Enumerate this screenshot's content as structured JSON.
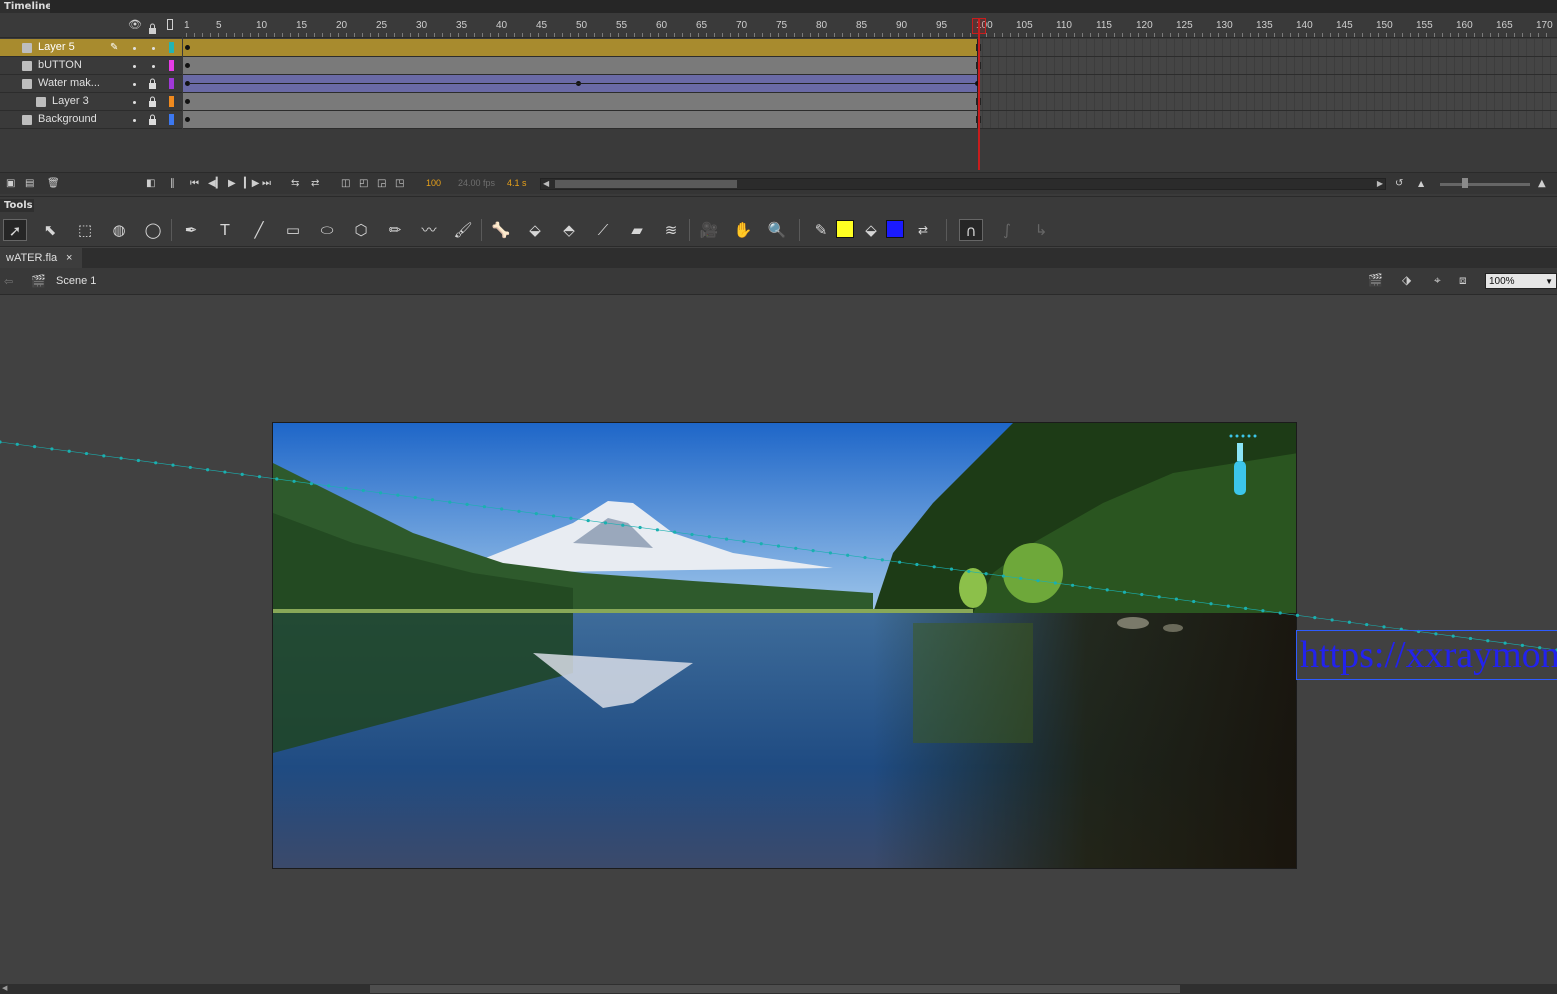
{
  "timeline": {
    "tab_label": "Timeline",
    "ruler_ticks": [
      "1",
      "5",
      "10",
      "15",
      "20",
      "25",
      "30",
      "35",
      "40",
      "45",
      "50",
      "55",
      "60",
      "65",
      "70",
      "75",
      "80",
      "85",
      "90",
      "95",
      "100",
      "105",
      "110",
      "115",
      "120",
      "125",
      "130",
      "135",
      "140",
      "145",
      "150",
      "155",
      "160",
      "165",
      "170"
    ],
    "layers": [
      {
        "name": "Layer 5",
        "color": "#23b4b4",
        "selected": true
      },
      {
        "name": "bUTTON",
        "color": "#e63ce6",
        "selected": false
      },
      {
        "name": "Water mak...",
        "color": "#a038d8",
        "selected": false
      },
      {
        "name": "Layer 3",
        "color": "#f08a1e",
        "selected": false
      },
      {
        "name": "Background",
        "color": "#3c78f0",
        "selected": false
      }
    ],
    "current_frame": "100",
    "fps": "24.00 fps",
    "elapsed": "4.1 s"
  },
  "tools": {
    "tab_label": "Tools",
    "stroke_color": "#ffff22",
    "fill_color": "#1a1aff"
  },
  "document": {
    "tab_label": "wATER.fla",
    "close_glyph": "×",
    "scene_label": "Scene 1",
    "zoom": "100%"
  },
  "stage": {
    "url_text": "https://xxraymon"
  }
}
